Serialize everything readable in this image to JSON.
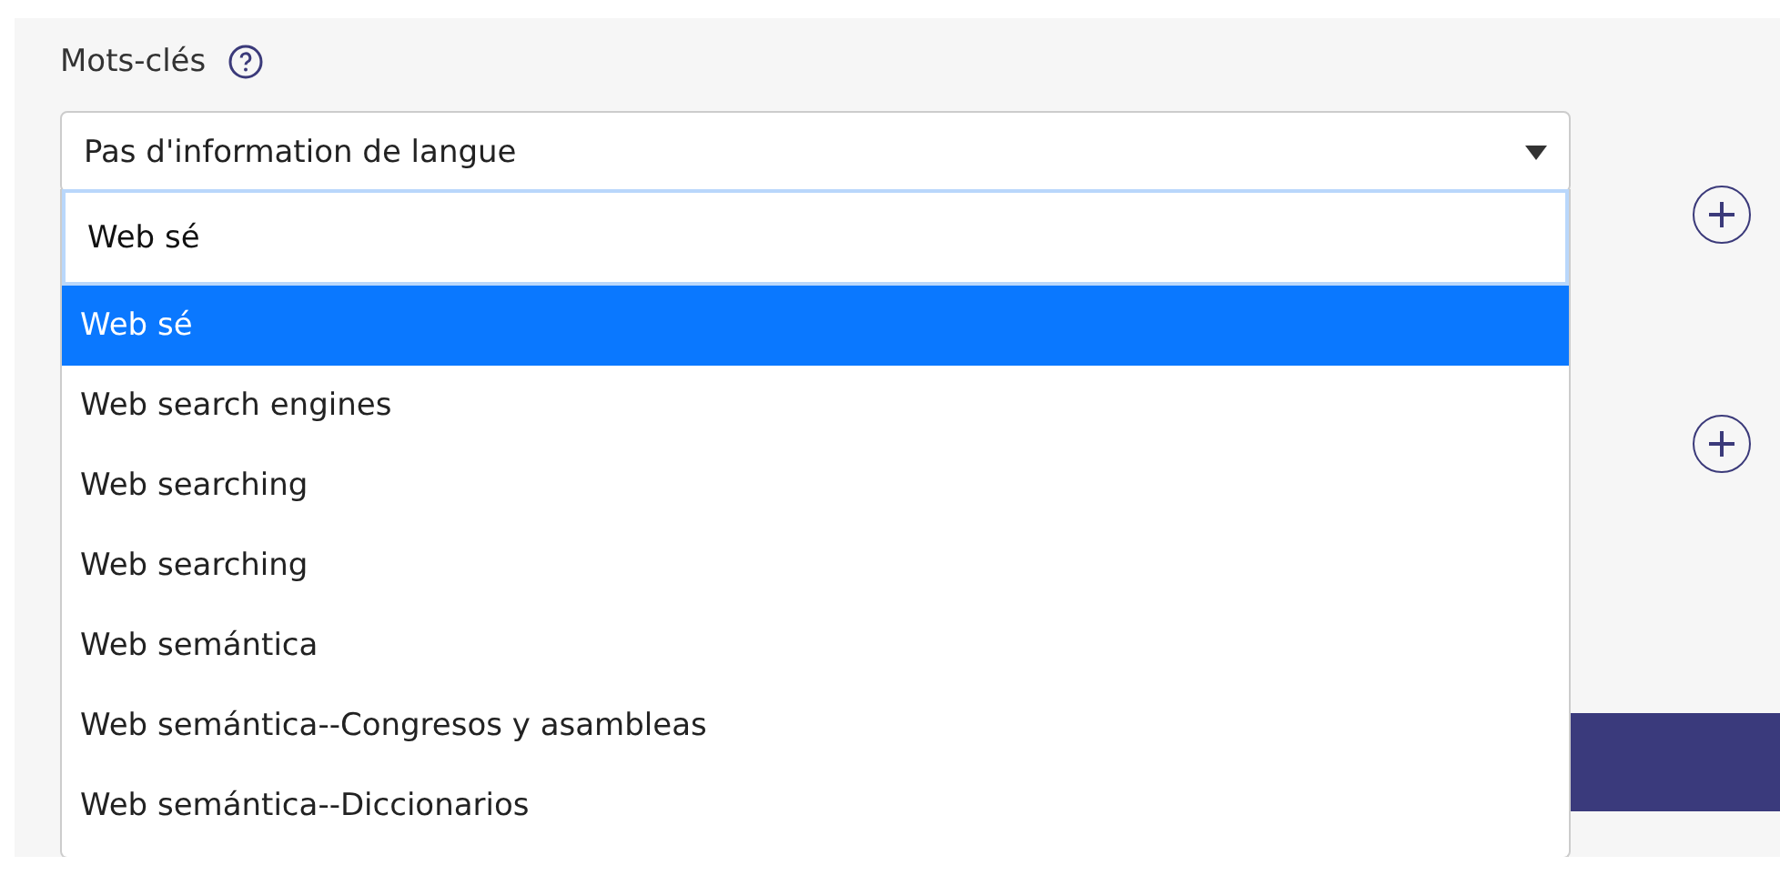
{
  "field": {
    "label": "Mots-clés",
    "value": "Pas d'information de langue",
    "expanded": true
  },
  "search": {
    "value": "Web sé"
  },
  "options": [
    {
      "label": "Web sé",
      "selected": true
    },
    {
      "label": "Web search engines",
      "selected": false
    },
    {
      "label": "Web searching",
      "selected": false
    },
    {
      "label": "Web searching",
      "selected": false
    },
    {
      "label": "Web semántica",
      "selected": false
    },
    {
      "label": "Web semántica--Congresos y asambleas",
      "selected": false
    },
    {
      "label": "Web semántica--Diccionarios",
      "selected": false
    }
  ]
}
